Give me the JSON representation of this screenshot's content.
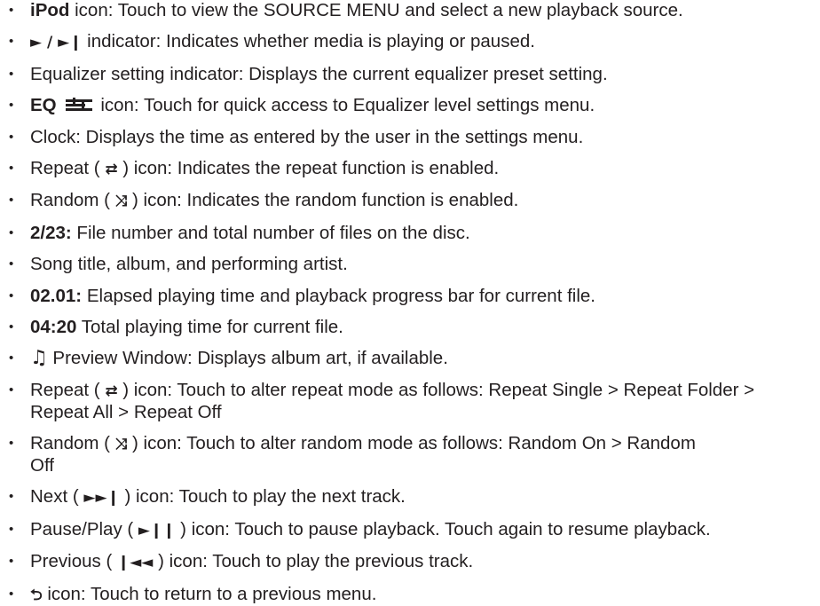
{
  "items": [
    {
      "bold": "iPod",
      "text": " icon: Touch to view the SOURCE MENU and select a new playback source."
    },
    {
      "sym": "► / ►❙",
      "text": " indicator: Indicates whether media is playing or paused."
    },
    {
      "text": "Equalizer setting indicator: Displays the current equalizer preset setting."
    },
    {
      "bold": "EQ",
      "text": " icon: Touch for quick access to Equalizer level settings menu.",
      "icon": "equalizer-bars-icon"
    },
    {
      "text": "Clock: Displays the time as entered by the user in the settings menu."
    },
    {
      "pre": "Repeat ( ",
      "sym": "⇄",
      "text": " ) icon: Indicates the repeat function is enabled.",
      "icon": "repeat-icon"
    },
    {
      "pre": "Random ( ",
      "sym": "⤨",
      "text": " ) icon: Indicates the random function is enabled.",
      "icon": "random-icon"
    },
    {
      "bold": "2/23:",
      "text": " File number and total number of files on the disc."
    },
    {
      "text": "Song title, album, and performing artist."
    },
    {
      "bold": "02.01:",
      "text": " Elapsed playing time and playback progress bar for current file."
    },
    {
      "bold": "04:20",
      "text": " Total playing time for current file."
    },
    {
      "sym": "♫",
      "text": " Preview Window: Displays album art, if available.",
      "icon": "music-note-icon"
    },
    {
      "pre": "Repeat ( ",
      "sym": "⇄",
      "text": " ) icon: Touch to alter repeat mode as follows: Repeat Single > Repeat Folder > Repeat All > Repeat Off",
      "icon": "repeat-icon"
    },
    {
      "pre": "Random ( ",
      "sym": "⤨",
      "text": " ) icon: Touch to alter random mode as follows: Random On > Random Off",
      "icon": "random-icon"
    },
    {
      "pre": "Next ( ",
      "sym": "►►❙",
      "text": " ) icon: Touch to play the next track.",
      "icon": "next-track-icon"
    },
    {
      "pre": "Pause/Play ( ",
      "sym": "►❙❙",
      "text": " ) icon: Touch to pause playback. Touch again to resume playback.",
      "icon": "play-pause-icon"
    },
    {
      "pre": "Previous ( ",
      "sym": "❙◄◄",
      "text": " ) icon: Touch to play the previous track.",
      "icon": "previous-track-icon"
    },
    {
      "sym": "⮌",
      "text": " icon: Touch to return to a previous menu.",
      "icon": "back-arrow-icon"
    }
  ]
}
